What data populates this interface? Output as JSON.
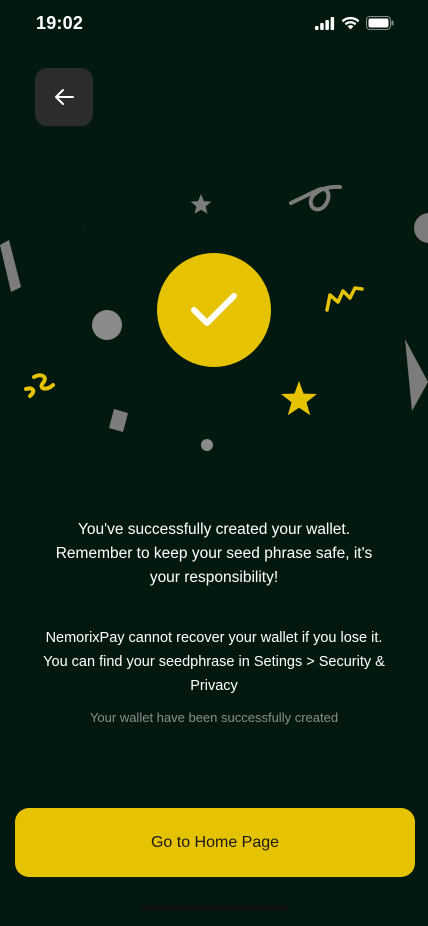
{
  "status_bar": {
    "time": "19:02"
  },
  "icons": {
    "back": "arrow-left-icon",
    "success": "checkmark-icon",
    "signal": "cellular-signal-icon",
    "wifi": "wifi-icon",
    "battery": "battery-icon"
  },
  "colors": {
    "background": "#03190f",
    "accent": "#e6c300",
    "back_button": "#2b2d2c",
    "confetti_gray": "#7c7c7c",
    "caption_text": "#8a8f8c"
  },
  "content": {
    "primary_message": "You've successfully created your wallet. Remember to keep your seed phrase safe, it's your responsibility!",
    "secondary_message": "NemorixPay cannot recover your wallet if you lose it. You can find your seedphrase in Setings > Security & Privacy",
    "caption": "Your wallet have been successfully created"
  },
  "actions": {
    "home_button_label": "Go to Home Page"
  }
}
